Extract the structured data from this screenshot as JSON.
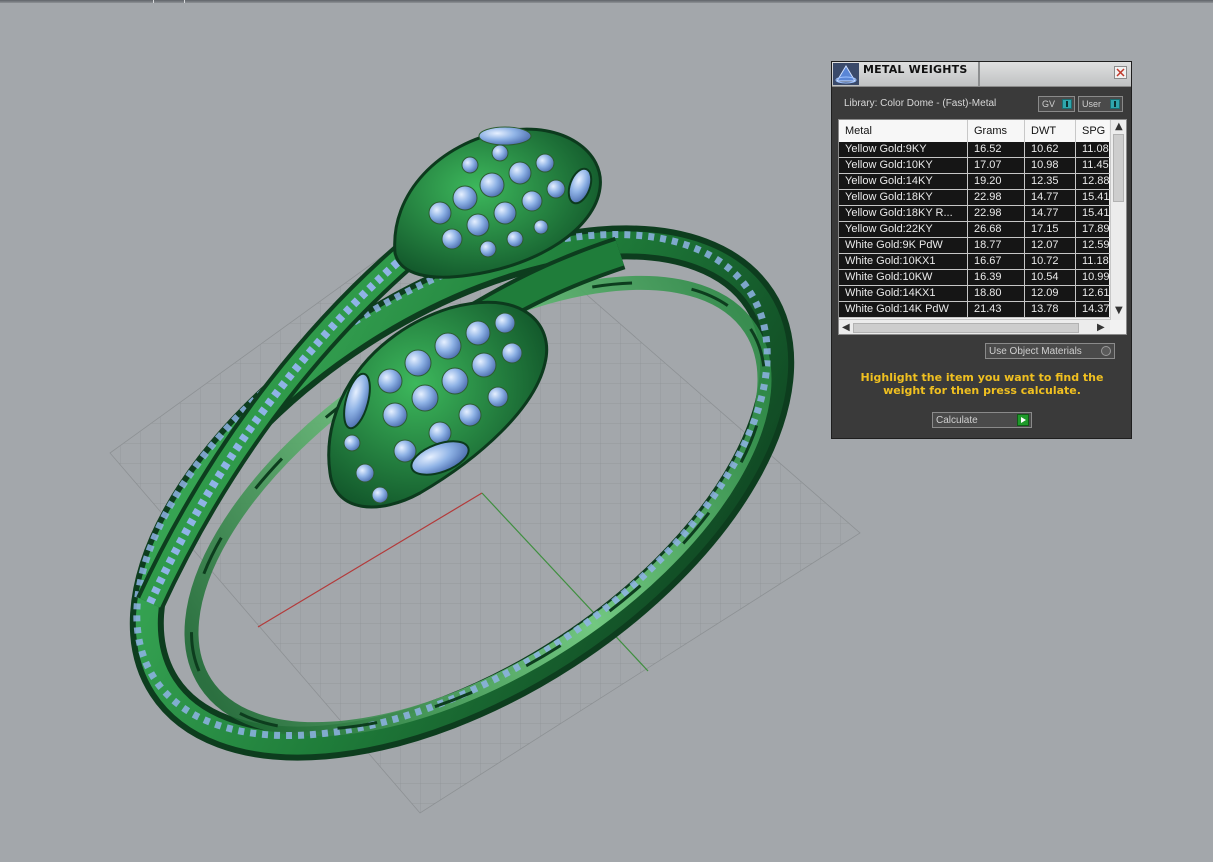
{
  "panel": {
    "title": "METAL WEIGHTS",
    "library_label": "Library: Color Dome - (Fast)-Metal",
    "toggles": {
      "gv_label": "GV",
      "user_label": "User"
    },
    "table": {
      "columns": [
        "Metal",
        "Grams",
        "DWT",
        "SPG"
      ],
      "rows": [
        [
          "Yellow Gold:9KY",
          "16.52",
          "10.62",
          "11.08"
        ],
        [
          "Yellow Gold:10KY",
          "17.07",
          "10.98",
          "11.45"
        ],
        [
          "Yellow Gold:14KY",
          "19.20",
          "12.35",
          "12.88"
        ],
        [
          "Yellow Gold:18KY",
          "22.98",
          "14.77",
          "15.41"
        ],
        [
          "Yellow Gold:18KY R...",
          "22.98",
          "14.77",
          "15.41"
        ],
        [
          "Yellow Gold:22KY",
          "26.68",
          "17.15",
          "17.89"
        ],
        [
          "White Gold:9K PdW",
          "18.77",
          "12.07",
          "12.59"
        ],
        [
          "White Gold:10KX1",
          "16.67",
          "10.72",
          "11.18"
        ],
        [
          "White Gold:10KW",
          "16.39",
          "10.54",
          "10.99"
        ],
        [
          "White Gold:14KX1",
          "18.80",
          "12.09",
          "12.61"
        ],
        [
          "White Gold:14K PdW",
          "21.43",
          "13.78",
          "14.37"
        ]
      ]
    },
    "use_object_materials_label": "Use Object Materials",
    "instruction": "Highlight the item you want to find the weight for then press calculate.",
    "calculate_label": "Calculate"
  },
  "colors": {
    "viewport_bg": "#a3a7ab",
    "panel_bg": "#3a3a3a",
    "instruction_text": "#f0c020",
    "model_green": "#2f9a4a",
    "gem_blue": "#8fb3e6",
    "axis_x": "#b33a3a",
    "axis_y": "#3f8f3f"
  }
}
